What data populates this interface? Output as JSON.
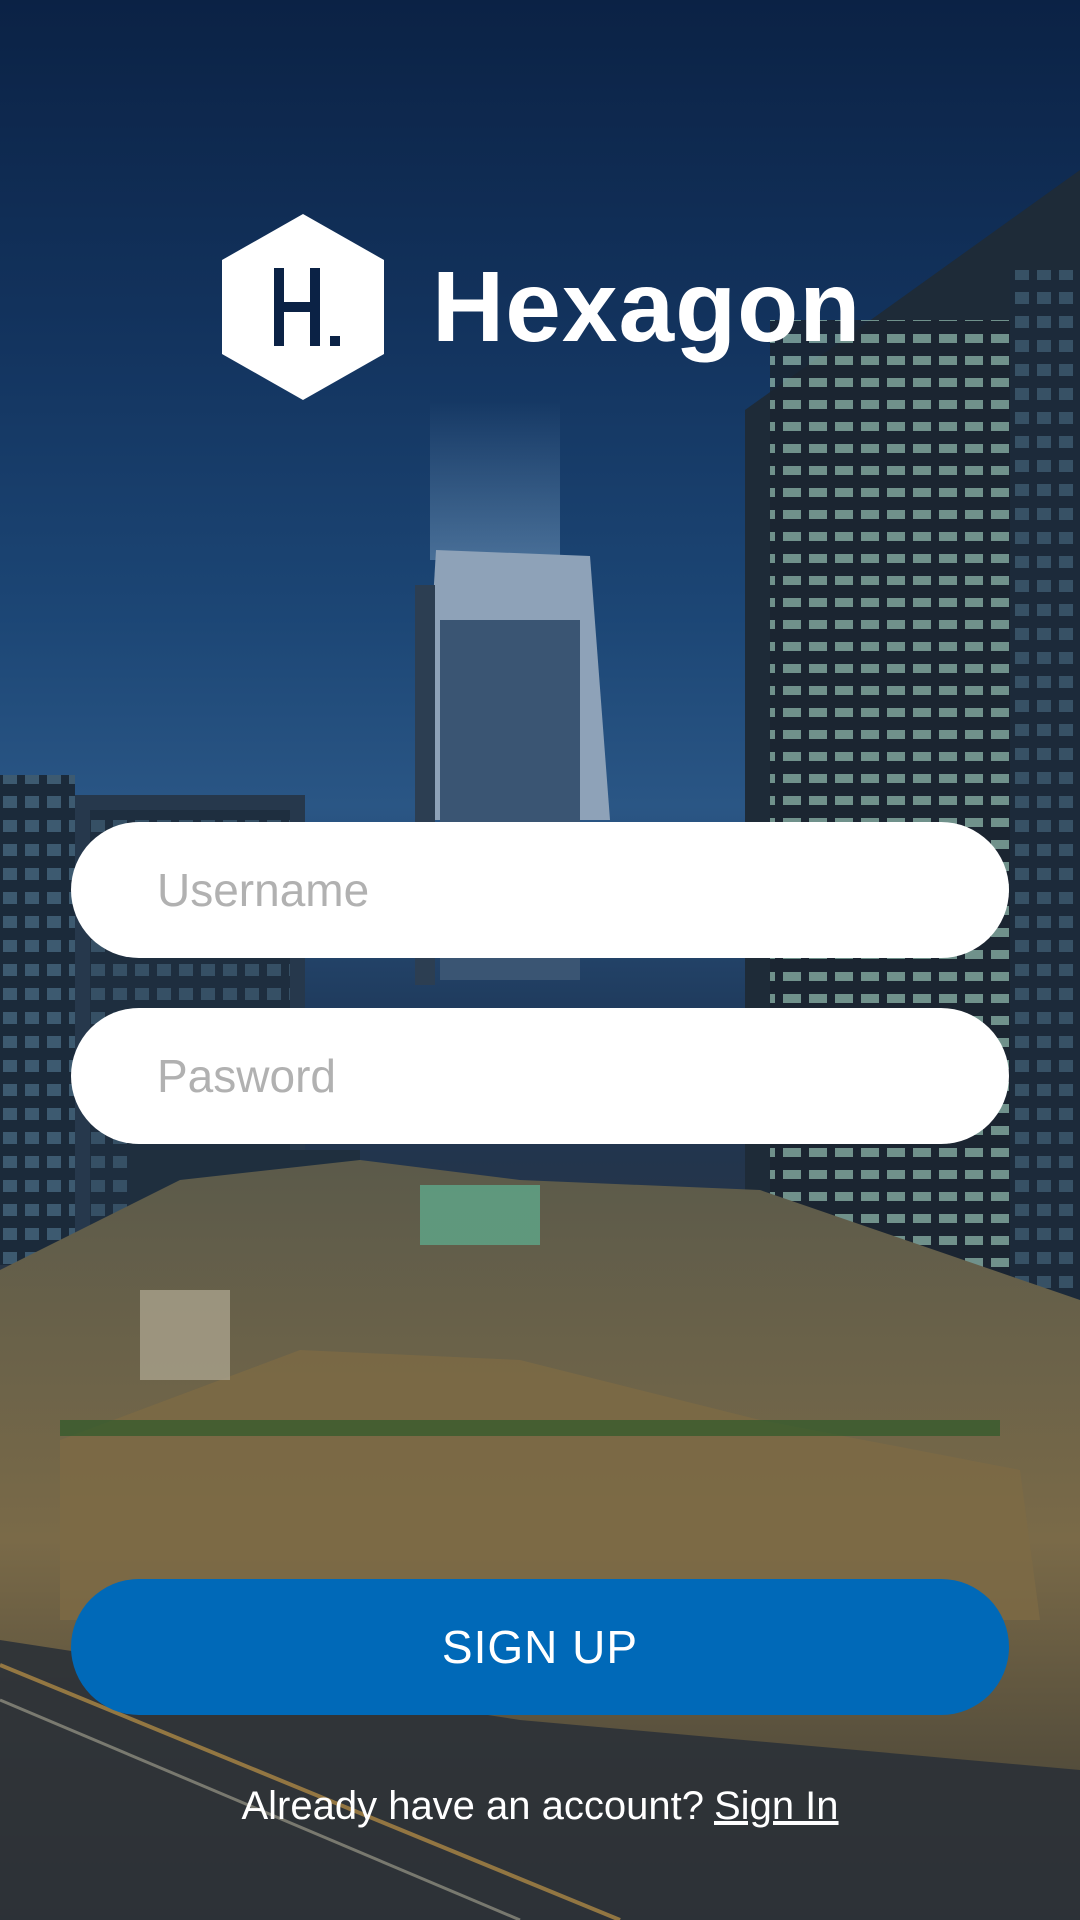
{
  "brand": {
    "name": "Hexagon",
    "logo_letter": "H.",
    "logo_icon": "hexagon-logo-icon"
  },
  "form": {
    "username_placeholder": "Username",
    "password_placeholder": "Pasword",
    "signup_label": "SIGN UP"
  },
  "footer": {
    "prompt": "Already have an account?",
    "signin_label": "Sign In"
  },
  "colors": {
    "accent": "#0069b8",
    "field_background": "#ffffff",
    "placeholder": "#b1b1b1",
    "text_on_dark": "#ffffff"
  }
}
